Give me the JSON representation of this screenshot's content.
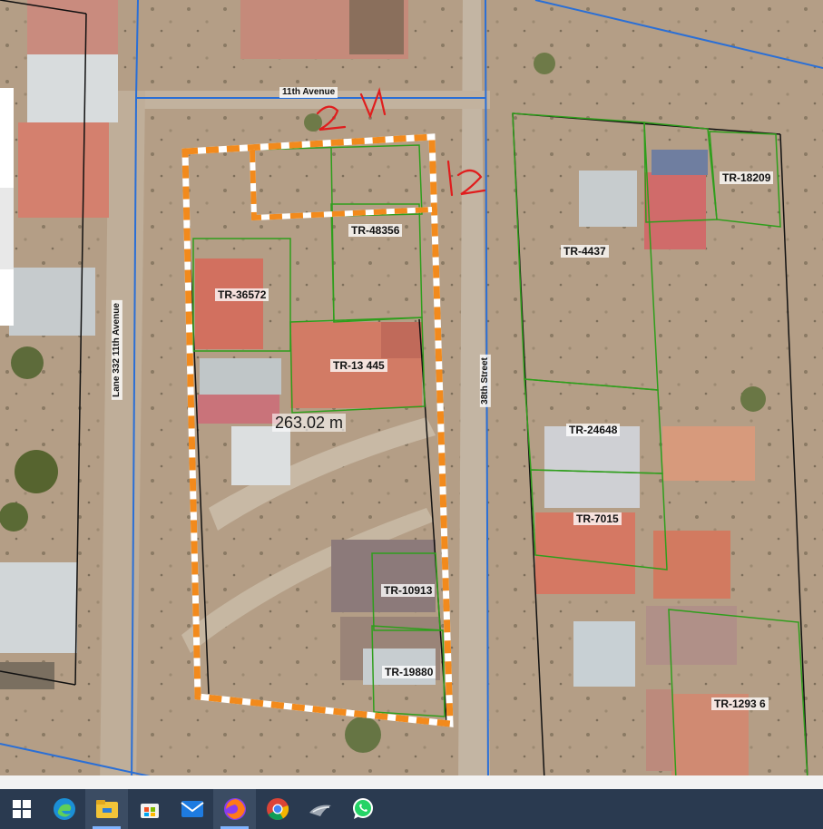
{
  "map": {
    "roads": {
      "top": "11th Avenue",
      "left": "Lane 332 11th Avenue",
      "right": "38th Street"
    },
    "parcels": [
      {
        "id": "TR-48356"
      },
      {
        "id": "TR-36572"
      },
      {
        "id": "TR-13 445"
      },
      {
        "id": "TR-10913"
      },
      {
        "id": "TR-19880"
      },
      {
        "id": "TR-4437"
      },
      {
        "id": "TR-18209"
      },
      {
        "id": "TR-24648"
      },
      {
        "id": "TR-7015"
      },
      {
        "id": "TR-1293 6"
      }
    ],
    "measurement": "263.02 m",
    "annotations": {
      "top_edge": "21",
      "right_edge": "12"
    },
    "colors": {
      "selection": "#f28a1c",
      "parcel_outline": "#2f9e1c",
      "road_line": "#2a6fd6",
      "annotation": "#e01d1d"
    }
  },
  "taskbar": {
    "items": [
      {
        "icon": "windows-start-icon"
      },
      {
        "icon": "edge-browser-icon"
      },
      {
        "icon": "file-explorer-icon",
        "active": true
      },
      {
        "icon": "microsoft-store-icon"
      },
      {
        "icon": "mail-icon"
      },
      {
        "icon": "firefox-icon",
        "active": true
      },
      {
        "icon": "chrome-icon"
      },
      {
        "icon": "inkscape-icon"
      },
      {
        "icon": "whatsapp-icon"
      }
    ]
  }
}
